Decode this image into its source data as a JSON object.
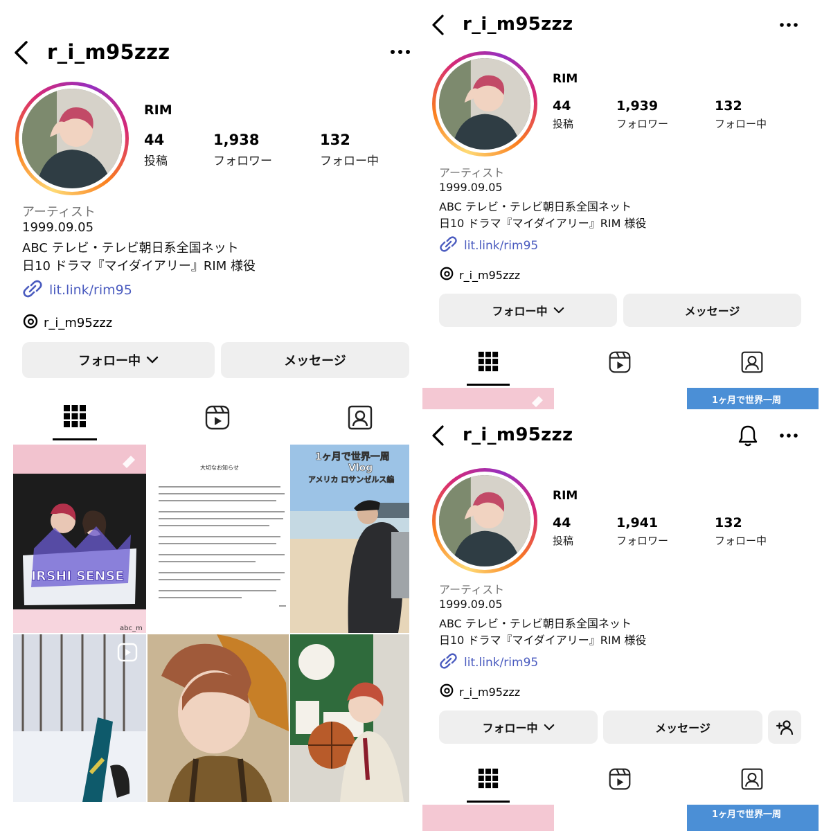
{
  "panels": {
    "left": {
      "username": "r_i_m95zzz",
      "display_name": "RIM",
      "stats": [
        {
          "num": "44",
          "label": "投稿"
        },
        {
          "num": "1,938",
          "label": "フォロワー"
        },
        {
          "num": "132",
          "label": "フォロー中"
        }
      ],
      "bio": {
        "category": "アーティスト",
        "lines": [
          "1999.09.05",
          "ABC テレビ・テレビ朝日系全国ネット",
          "日10 ドラマ『マイダイアリー』RIM 様役"
        ],
        "link": "lit.link/rim95",
        "threads": "r_i_m95zzz"
      },
      "buttons": {
        "following": "フォロー中",
        "message": "メッセージ"
      },
      "grid": {
        "post2_title": "大切なお知らせ",
        "post3_caption_line1": "1ヶ月で世界一周",
        "post3_caption_line2": "Vlog",
        "post3_caption_line3": "アメリカ ロサンゼルス編",
        "post1_tag": "abc_m",
        "post1_towel": "IRSHI SENSE"
      }
    },
    "top_right": {
      "username": "r_i_m95zzz",
      "display_name": "RIM",
      "stats": [
        {
          "num": "44",
          "label": "投稿"
        },
        {
          "num": "1,939",
          "label": "フォロワー"
        },
        {
          "num": "132",
          "label": "フォロー中"
        }
      ],
      "bio": {
        "category": "アーティスト",
        "lines": [
          "1999.09.05",
          "ABC テレビ・テレビ朝日系全国ネット",
          "日10 ドラマ『マイダイアリー』RIM 様役"
        ],
        "link": "lit.link/rim95",
        "threads": "r_i_m95zzz"
      },
      "buttons": {
        "following": "フォロー中",
        "message": "メッセージ"
      },
      "strip_caption": "1ヶ月で世界一周"
    },
    "bottom_right": {
      "username": "r_i_m95zzz",
      "display_name": "RIM",
      "stats": [
        {
          "num": "44",
          "label": "投稿"
        },
        {
          "num": "1,941",
          "label": "フォロワー"
        },
        {
          "num": "132",
          "label": "フォロー中"
        }
      ],
      "bio": {
        "category": "アーティスト",
        "lines": [
          "1999.09.05",
          "ABC テレビ・テレビ朝日系全国ネット",
          "日10 ドラマ『マイダイアリー』RIM 様役"
        ],
        "link": "lit.link/rim95",
        "threads": "r_i_m95zzz"
      },
      "buttons": {
        "following": "フォロー中",
        "message": "メッセージ"
      },
      "strip_caption": "1ヶ月で世界一周"
    }
  },
  "icons": {
    "back": "chevron-left-icon",
    "more": "more-horizontal-icon",
    "bell": "bell-icon",
    "link": "link-icon",
    "threads": "threads-icon",
    "grid_tab": "grid-icon",
    "reels_tab": "reels-icon",
    "tagged_tab": "tagged-icon",
    "add_person": "add-person-icon"
  },
  "colors": {
    "link": "#4a5bbf",
    "button_bg": "#efefef",
    "category": "#737373"
  }
}
